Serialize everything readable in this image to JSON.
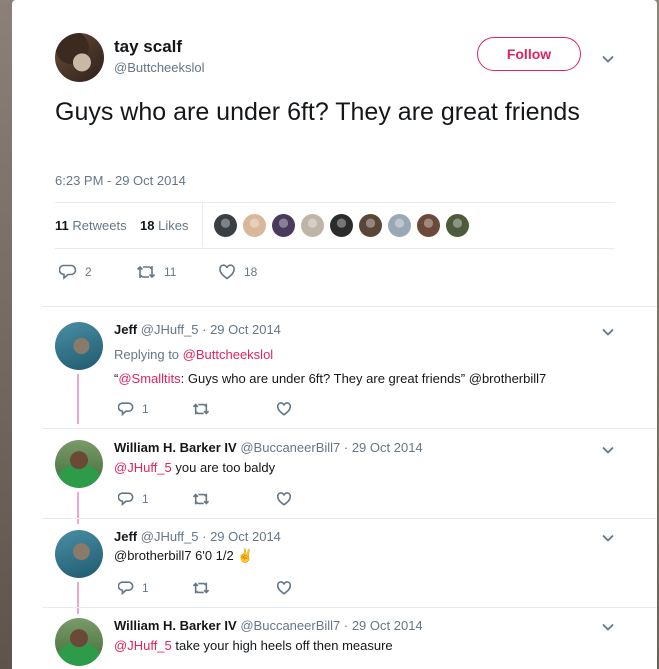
{
  "main": {
    "name": "tay scalf",
    "handle": "@Buttcheekslol",
    "follow_label": "Follow",
    "text": "Guys who are under 6ft? They are great friends",
    "timestamp": "6:23 PM - 29 Oct 2014",
    "retweets_count": "11",
    "retweets_label": "Retweets",
    "likes_count": "18",
    "likes_label": "Likes",
    "reply_count": "2",
    "retweet_action_count": "11",
    "like_action_count": "18",
    "liker_colors": [
      "#3a3f44",
      "#d9b79a",
      "#4a3b5e",
      "#bfb4a8",
      "#2b2b2b",
      "#5a4636",
      "#9aa7b4",
      "#6b4a3a",
      "#4d5a3c"
    ]
  },
  "replies": [
    {
      "name": "Jeff",
      "handle": "@JHuff_5",
      "date": "· 29 Oct 2014",
      "replying_prefix": "Replying to",
      "replying_to": "@Buttcheekslol",
      "quote_open": "“",
      "mention": "@Smalltits",
      "text_rest": ": Guys who are under 6ft? They are great friends” @brotherbill7",
      "reply_count": "1"
    },
    {
      "name": "William H. Barker IV",
      "handle": "@BuccaneerBill7",
      "date": "· 29 Oct 2014",
      "mention": "@JHuff_5",
      "text_rest": " you are too baldy",
      "reply_count": "1"
    },
    {
      "name": "Jeff",
      "handle": "@JHuff_5",
      "date": "· 29 Oct 2014",
      "text": "@brotherbill7 6'0 1/2 ",
      "emoji": "✌",
      "reply_count": "1"
    },
    {
      "name": "William H. Barker IV",
      "handle": "@BuccaneerBill7",
      "date": "· 29 Oct 2014",
      "mention": "@JHuff_5",
      "text_rest": " take your high heels off then measure"
    }
  ],
  "icons": [
    "chevron-down-icon",
    "reply-icon",
    "retweet-icon",
    "like-icon"
  ],
  "colors": {
    "accent": "#e0245e",
    "secondary_text": "#657786",
    "thread_line": "#f0a6c9"
  }
}
